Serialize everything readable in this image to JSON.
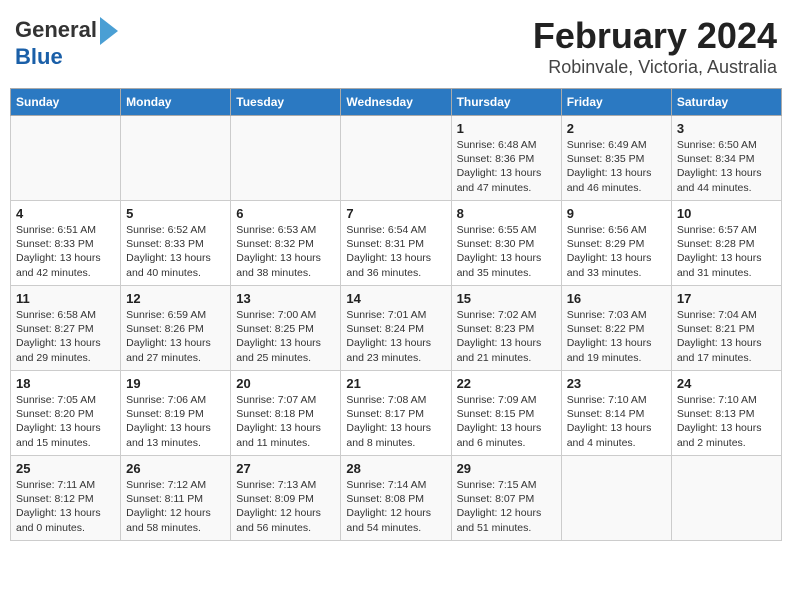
{
  "header": {
    "logo_line1": "General",
    "logo_line2": "Blue",
    "title": "February 2024",
    "subtitle": "Robinvale, Victoria, Australia"
  },
  "days_of_week": [
    "Sunday",
    "Monday",
    "Tuesday",
    "Wednesday",
    "Thursday",
    "Friday",
    "Saturday"
  ],
  "weeks": [
    [
      {
        "day": "",
        "info": ""
      },
      {
        "day": "",
        "info": ""
      },
      {
        "day": "",
        "info": ""
      },
      {
        "day": "",
        "info": ""
      },
      {
        "day": "1",
        "info": "Sunrise: 6:48 AM\nSunset: 8:36 PM\nDaylight: 13 hours\nand 47 minutes."
      },
      {
        "day": "2",
        "info": "Sunrise: 6:49 AM\nSunset: 8:35 PM\nDaylight: 13 hours\nand 46 minutes."
      },
      {
        "day": "3",
        "info": "Sunrise: 6:50 AM\nSunset: 8:34 PM\nDaylight: 13 hours\nand 44 minutes."
      }
    ],
    [
      {
        "day": "4",
        "info": "Sunrise: 6:51 AM\nSunset: 8:33 PM\nDaylight: 13 hours\nand 42 minutes."
      },
      {
        "day": "5",
        "info": "Sunrise: 6:52 AM\nSunset: 8:33 PM\nDaylight: 13 hours\nand 40 minutes."
      },
      {
        "day": "6",
        "info": "Sunrise: 6:53 AM\nSunset: 8:32 PM\nDaylight: 13 hours\nand 38 minutes."
      },
      {
        "day": "7",
        "info": "Sunrise: 6:54 AM\nSunset: 8:31 PM\nDaylight: 13 hours\nand 36 minutes."
      },
      {
        "day": "8",
        "info": "Sunrise: 6:55 AM\nSunset: 8:30 PM\nDaylight: 13 hours\nand 35 minutes."
      },
      {
        "day": "9",
        "info": "Sunrise: 6:56 AM\nSunset: 8:29 PM\nDaylight: 13 hours\nand 33 minutes."
      },
      {
        "day": "10",
        "info": "Sunrise: 6:57 AM\nSunset: 8:28 PM\nDaylight: 13 hours\nand 31 minutes."
      }
    ],
    [
      {
        "day": "11",
        "info": "Sunrise: 6:58 AM\nSunset: 8:27 PM\nDaylight: 13 hours\nand 29 minutes."
      },
      {
        "day": "12",
        "info": "Sunrise: 6:59 AM\nSunset: 8:26 PM\nDaylight: 13 hours\nand 27 minutes."
      },
      {
        "day": "13",
        "info": "Sunrise: 7:00 AM\nSunset: 8:25 PM\nDaylight: 13 hours\nand 25 minutes."
      },
      {
        "day": "14",
        "info": "Sunrise: 7:01 AM\nSunset: 8:24 PM\nDaylight: 13 hours\nand 23 minutes."
      },
      {
        "day": "15",
        "info": "Sunrise: 7:02 AM\nSunset: 8:23 PM\nDaylight: 13 hours\nand 21 minutes."
      },
      {
        "day": "16",
        "info": "Sunrise: 7:03 AM\nSunset: 8:22 PM\nDaylight: 13 hours\nand 19 minutes."
      },
      {
        "day": "17",
        "info": "Sunrise: 7:04 AM\nSunset: 8:21 PM\nDaylight: 13 hours\nand 17 minutes."
      }
    ],
    [
      {
        "day": "18",
        "info": "Sunrise: 7:05 AM\nSunset: 8:20 PM\nDaylight: 13 hours\nand 15 minutes."
      },
      {
        "day": "19",
        "info": "Sunrise: 7:06 AM\nSunset: 8:19 PM\nDaylight: 13 hours\nand 13 minutes."
      },
      {
        "day": "20",
        "info": "Sunrise: 7:07 AM\nSunset: 8:18 PM\nDaylight: 13 hours\nand 11 minutes."
      },
      {
        "day": "21",
        "info": "Sunrise: 7:08 AM\nSunset: 8:17 PM\nDaylight: 13 hours\nand 8 minutes."
      },
      {
        "day": "22",
        "info": "Sunrise: 7:09 AM\nSunset: 8:15 PM\nDaylight: 13 hours\nand 6 minutes."
      },
      {
        "day": "23",
        "info": "Sunrise: 7:10 AM\nSunset: 8:14 PM\nDaylight: 13 hours\nand 4 minutes."
      },
      {
        "day": "24",
        "info": "Sunrise: 7:10 AM\nSunset: 8:13 PM\nDaylight: 13 hours\nand 2 minutes."
      }
    ],
    [
      {
        "day": "25",
        "info": "Sunrise: 7:11 AM\nSunset: 8:12 PM\nDaylight: 13 hours\nand 0 minutes."
      },
      {
        "day": "26",
        "info": "Sunrise: 7:12 AM\nSunset: 8:11 PM\nDaylight: 12 hours\nand 58 minutes."
      },
      {
        "day": "27",
        "info": "Sunrise: 7:13 AM\nSunset: 8:09 PM\nDaylight: 12 hours\nand 56 minutes."
      },
      {
        "day": "28",
        "info": "Sunrise: 7:14 AM\nSunset: 8:08 PM\nDaylight: 12 hours\nand 54 minutes."
      },
      {
        "day": "29",
        "info": "Sunrise: 7:15 AM\nSunset: 8:07 PM\nDaylight: 12 hours\nand 51 minutes."
      },
      {
        "day": "",
        "info": ""
      },
      {
        "day": "",
        "info": ""
      }
    ]
  ]
}
